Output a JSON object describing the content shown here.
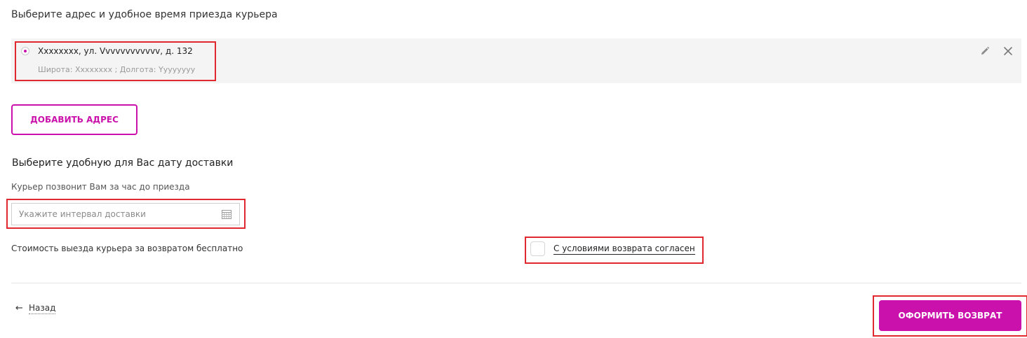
{
  "address_section": {
    "title": "Выберите адрес и удобное время приезда курьера",
    "address": {
      "line": "Xxxxxxxx, ул. Vvvvvvvvvvvv, д. 132",
      "coordinates": "Широта: Xxxxxxxx ; Долгота: Yyyyyyyy",
      "selected": true
    },
    "icons": {
      "edit": "pencil-icon",
      "delete": "close-icon"
    },
    "add_button_label": "ДОБАВИТЬ АДРЕС"
  },
  "delivery_section": {
    "title": "Выберите удобную для Вас дату доставки",
    "note": "Курьер позвонит Вам за час до приезда",
    "interval_input": {
      "placeholder": "Укажите интервал доставки",
      "value": ""
    },
    "calendar_icon": "calendar-icon"
  },
  "cost_note": "Стоимость выезда курьера за возвратом бесплатно",
  "agreement": {
    "label": "С условиями возврата согласен",
    "checked": false
  },
  "footer": {
    "back_arrow": "←",
    "back_label": "Назад",
    "submit_label": "ОФОРМИТЬ ВОЗВРАТ"
  },
  "colors": {
    "accent": "#cb11ab",
    "highlight": "#e0282e",
    "strip": "#f4f4f4"
  }
}
